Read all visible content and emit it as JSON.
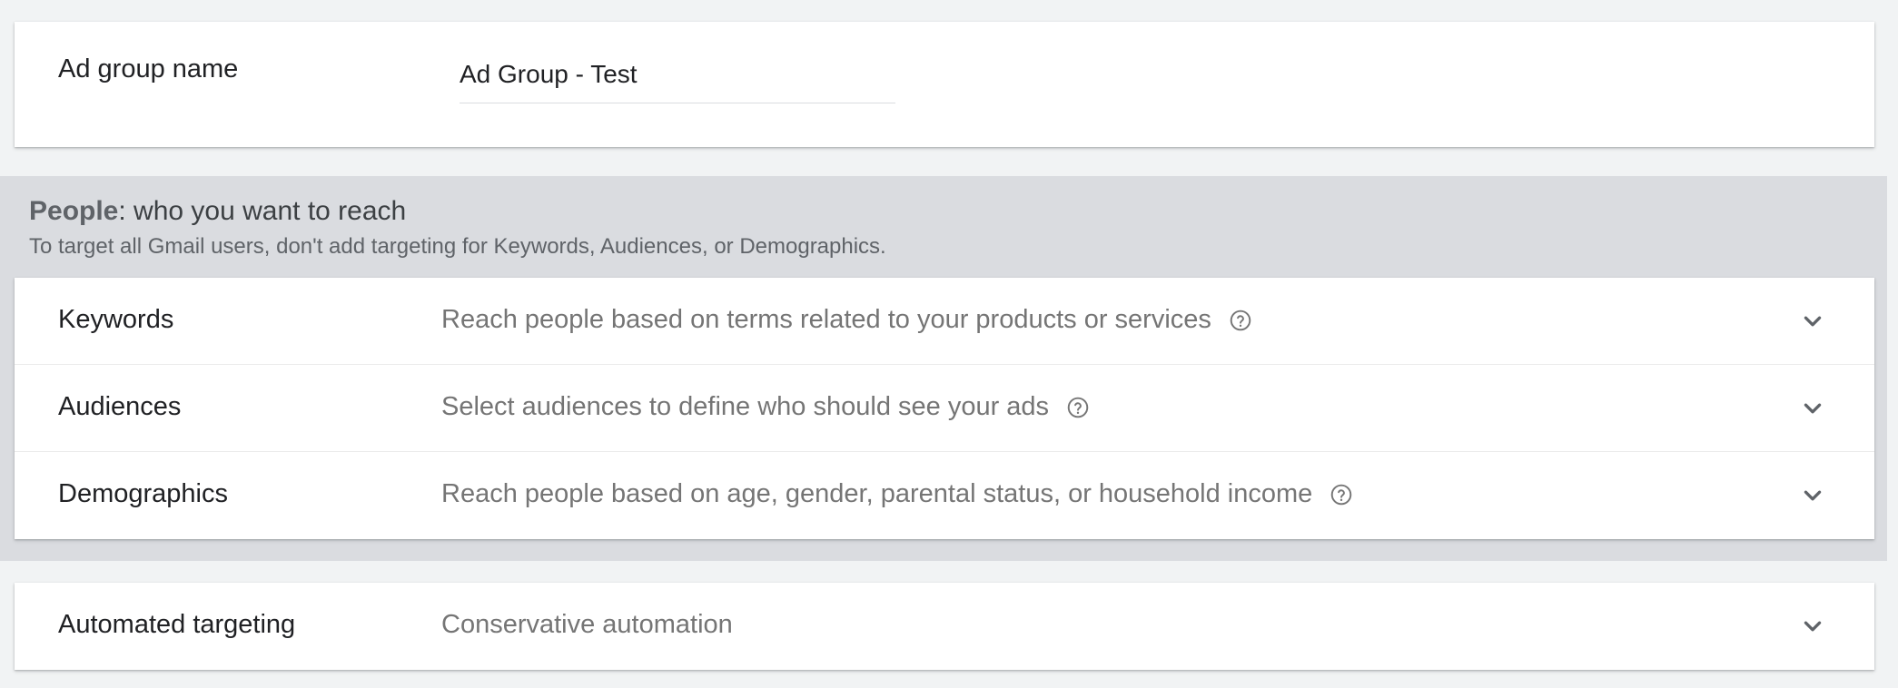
{
  "ad_group": {
    "label": "Ad group name",
    "value": "Ad Group - Test"
  },
  "people": {
    "title_bold": "People",
    "title_rest": ": who you want to reach",
    "subtitle": "To target all Gmail users, don't add targeting for Keywords, Audiences, or Demographics.",
    "rows": [
      {
        "label": "Keywords",
        "description": "Reach people based on terms related to your products or services",
        "help_icon": "help-circle-icon",
        "expand_icon": "chevron-down-icon"
      },
      {
        "label": "Audiences",
        "description": "Select audiences to define who should see your ads",
        "help_icon": "help-circle-icon",
        "expand_icon": "chevron-down-icon"
      },
      {
        "label": "Demographics",
        "description": "Reach people based on age, gender, parental status, or household income",
        "help_icon": "help-circle-icon",
        "expand_icon": "chevron-down-icon"
      }
    ]
  },
  "automated_targeting": {
    "label": "Automated targeting",
    "value": "Conservative automation",
    "expand_icon": "chevron-down-icon"
  },
  "colors": {
    "page_bg": "#f1f3f4",
    "section_bg": "#dadce0",
    "text_primary": "#202124",
    "text_secondary": "#757575"
  }
}
